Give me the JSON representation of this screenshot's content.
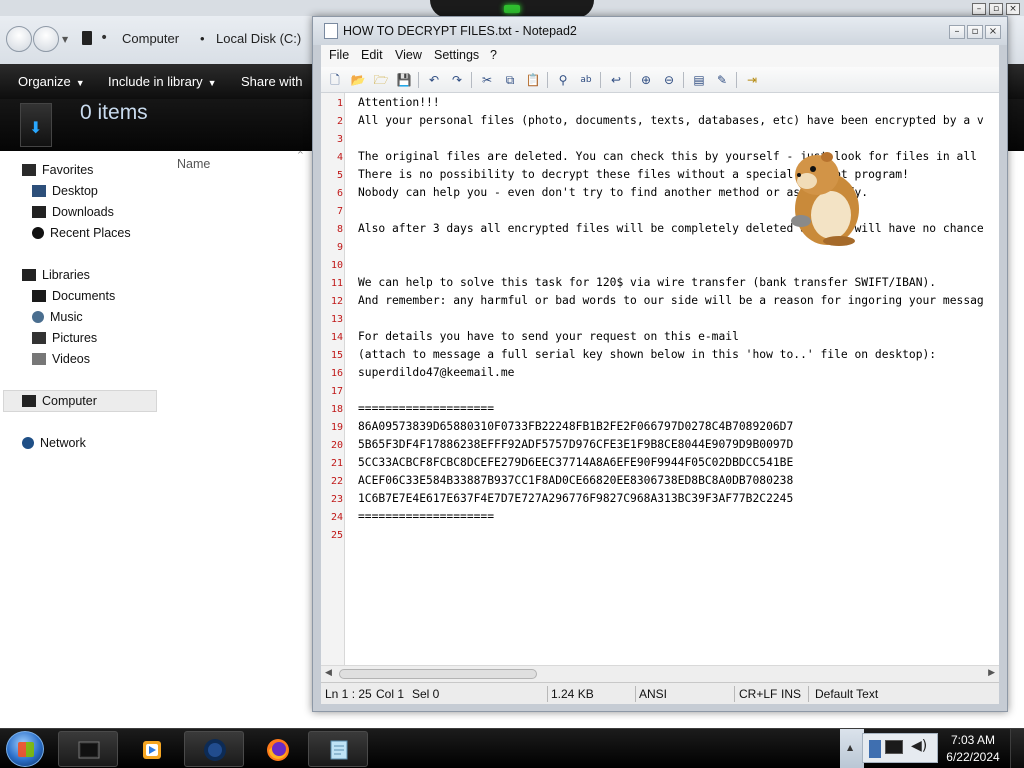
{
  "explorer": {
    "breadcrumb": [
      "Computer",
      "Local Disk (C:)"
    ],
    "toolbar": [
      {
        "label": "Organize"
      },
      {
        "label": "Include in library"
      },
      {
        "label": "Share with"
      }
    ],
    "items_count": "0 items",
    "column_name": "Name",
    "nav": {
      "favorites": "Favorites",
      "desktop": "Desktop",
      "downloads": "Downloads",
      "recent_places": "Recent Places",
      "libraries": "Libraries",
      "documents": "Documents",
      "music": "Music",
      "pictures": "Pictures",
      "videos": "Videos",
      "computer": "Computer",
      "network": "Network"
    }
  },
  "notepad": {
    "title": "HOW TO DECRYPT FILES.txt - Notepad2",
    "menu": [
      "File",
      "Edit",
      "View",
      "Settings",
      "?"
    ],
    "toolbar_icons": [
      "new-file-icon",
      "open-file-icon",
      "browse-icon",
      "save-icon",
      "undo-icon",
      "redo-icon",
      "cut-icon",
      "copy-icon",
      "paste-icon",
      "find-icon",
      "replace-icon",
      "word-wrap-icon",
      "zoom-in-icon",
      "zoom-out-icon",
      "scheme-icon",
      "customize-icon",
      "exit-icon"
    ],
    "line_numbers": [
      "1",
      "2",
      "3",
      "4",
      "5",
      "6",
      "7",
      "8",
      "9",
      "10",
      "11",
      "12",
      "13",
      "14",
      "15",
      "16",
      "17",
      "18",
      "19",
      "20",
      "21",
      "22",
      "23",
      "24",
      "25"
    ],
    "lines": [
      "Attention!!!",
      "All your personal files (photo, documents, texts, databases, etc) have been encrypted by a v",
      "",
      "The original files are deleted. You can check this by yourself - just look for files in all",
      "There is no possibility to decrypt these files without a special decrypt program!",
      "Nobody can help you - even don't try to find another method or ask anybody.",
      "",
      "Also after 3 days all encrypted files will be completely deleted and you will have no chance",
      "",
      "",
      "We can help to solve this task for 120$ via wire transfer (bank transfer SWIFT/IBAN).",
      "And remember: any harmful or bad words to our side will be a reason for ingoring your messag",
      "",
      "For details you have to send your request on this e-mail",
      "(attach to message a full serial key shown below in this 'how to..' file on desktop):",
      "superdildo47@keemail.me",
      "",
      "====================",
      "86A09573839D65880310F0733FB22248FB1B2FE2F066797D0278C4B7089206D7",
      "5B65F3DF4F17886238EFFF92ADF5757D976CFE3E1F9B8CE8044E9079D9B0097D",
      "5CC33ACBCF8FCBC8DCEFE279D6EEC37714A8A6EFE90F9944F05C02DBDCC541BE",
      "ACEF06C33E584B33887B937CC1F8AD0CE66820EE8306738ED8BC8A0DB7080238",
      "1C6B7E7E4E617E637F4E7D7E727A296776F9827C968A313BC39F3AF77B2C2245",
      "====================",
      ""
    ],
    "status": {
      "position": "Ln 1 : 25",
      "column": "Col 1",
      "selection": "Sel 0",
      "size": "1.24 KB",
      "encoding": "ANSI",
      "line_ending": "CR+LF",
      "mode": "INS",
      "scheme": "Default Text"
    }
  },
  "taskbar": {
    "buttons": [
      "explorer-icon",
      "media-player-icon",
      "firefox-icon-dark",
      "firefox-icon",
      "notepad-icon"
    ],
    "time": "7:03 AM",
    "date": "6/22/2024"
  }
}
